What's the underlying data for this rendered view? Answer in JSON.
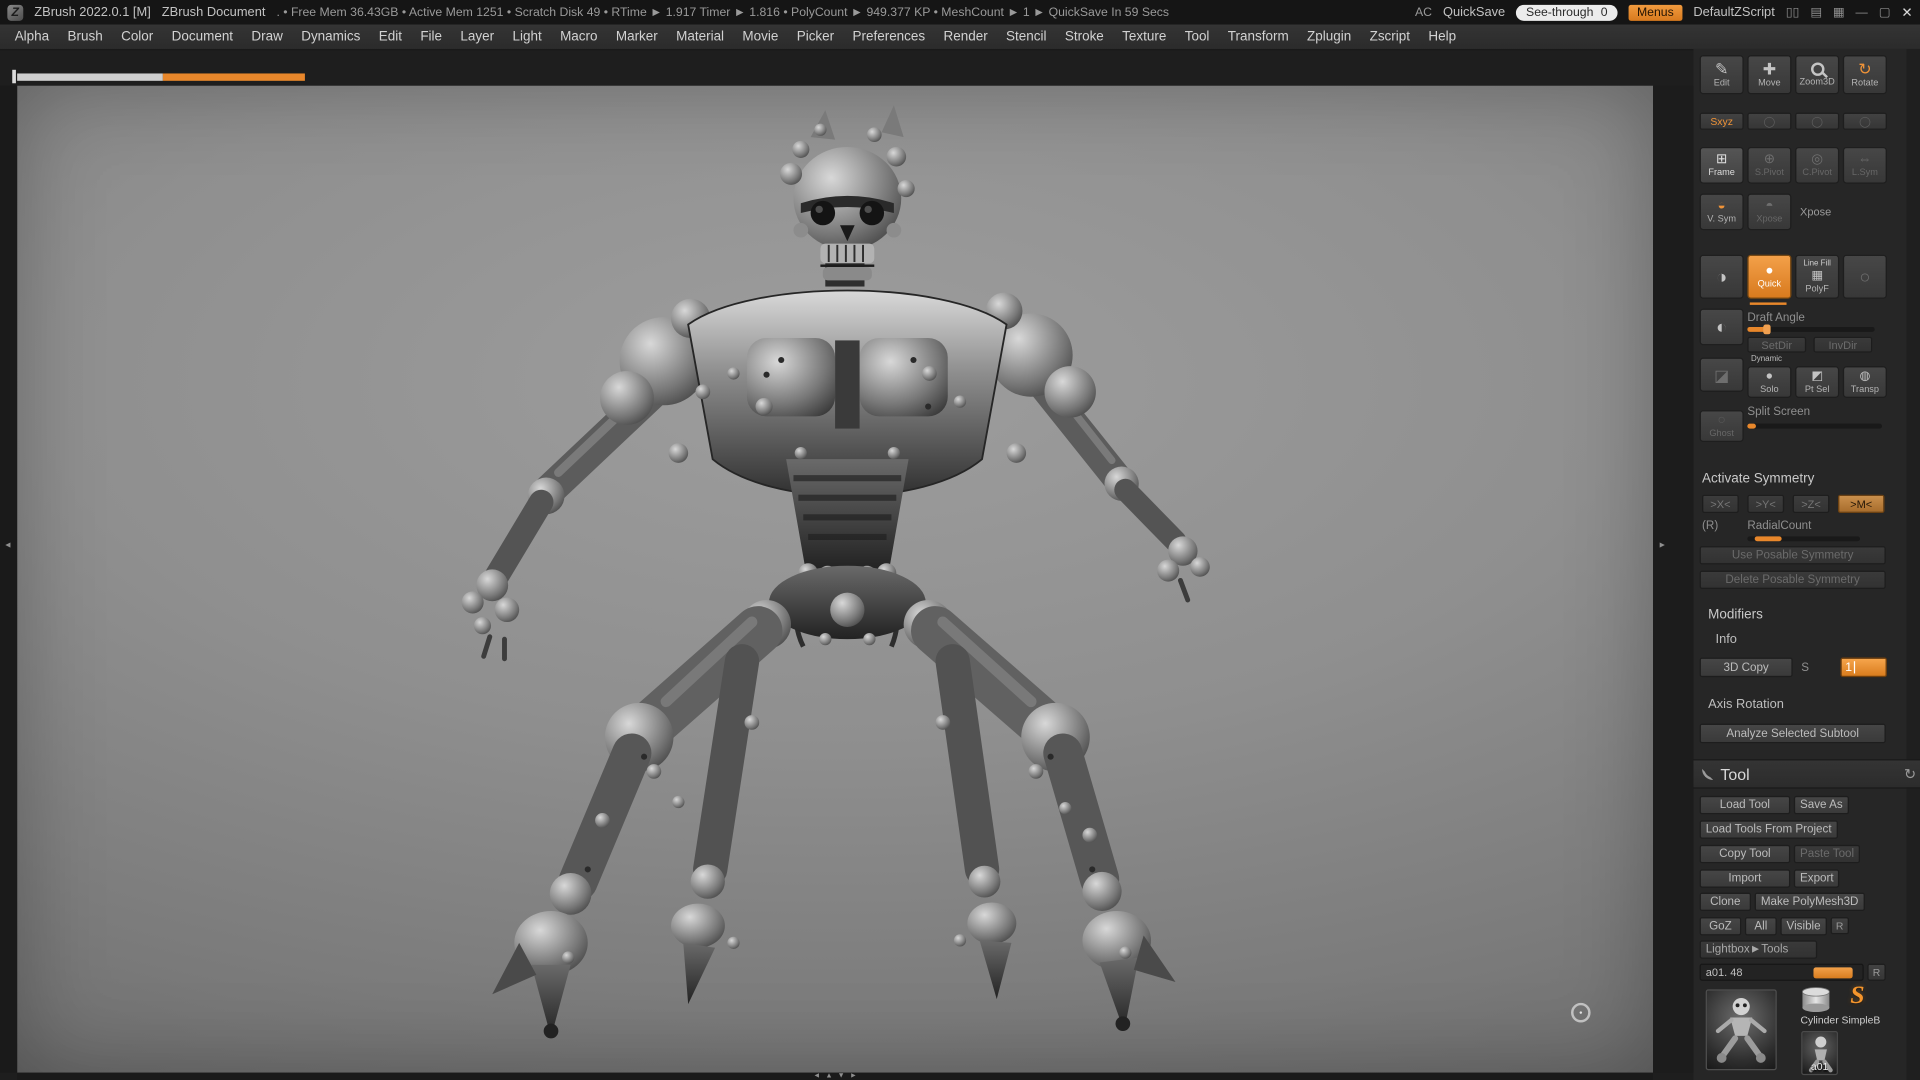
{
  "titlebar": {
    "app": "ZBrush 2022.0.1 [M]",
    "document": "ZBrush Document",
    "stats": ". • Free Mem 36.43GB • Active Mem 1251 • Scratch Disk 49 •  RTime ► 1.917 Timer ► 1.816 • PolyCount ► 949.377 KP • MeshCount ► 1   ► QuickSave In 59 Secs",
    "ac": "AC",
    "quicksave": "QuickSave",
    "see_through_label": "See-through",
    "see_through_value": "0",
    "menus": "Menus",
    "zscript": "DefaultZScript"
  },
  "menubar": {
    "items": [
      "Alpha",
      "Brush",
      "Color",
      "Document",
      "Draw",
      "Dynamics",
      "Edit",
      "File",
      "Layer",
      "Light",
      "Macro",
      "Marker",
      "Material",
      "Movie",
      "Picker",
      "Preferences",
      "Render",
      "Stencil",
      "Stroke",
      "Texture",
      "Tool",
      "Transform",
      "Zplugin",
      "Zscript",
      "Help"
    ]
  },
  "shelf": {
    "edit": "Edit",
    "move": "Move",
    "zoom3d": "Zoom3D",
    "rotate": "Rotate"
  },
  "transform": {
    "sxyz": "Sxyz",
    "frame": "Frame",
    "spivot": "S.Pivot",
    "cpivot": "C.Pivot",
    "lsym": "L.Sym",
    "vsym": "V. Sym",
    "xpose_btn": "Xpose",
    "xpose": "Xpose",
    "quick": "Quick",
    "line_fill": "Line Fill",
    "polyf": "PolyF",
    "draft_angle": "Draft Angle",
    "setdir": "SetDir",
    "invdir": "InvDir",
    "dynamic": "Dynamic",
    "solo": "Solo",
    "pt_sel": "Pt Sel",
    "transp": "Transp",
    "split_screen": "Split Screen",
    "ghost": "Ghost",
    "activate_symmetry": "Activate Symmetry",
    "sym_x": ">X<",
    "sym_y": ">Y<",
    "sym_z": ">Z<",
    "sym_m": ">M<",
    "r": "(R)",
    "radial_count": "RadialCount",
    "use_posable": "Use Posable Symmetry",
    "delete_posable": "Delete Posable Symmetry",
    "modifiers": "Modifiers",
    "info": "Info",
    "copy_3d": "3D Copy",
    "s": "S",
    "s_value": "1",
    "axis_rotation": "Axis Rotation",
    "analyze": "Analyze Selected Subtool"
  },
  "tool": {
    "title": "Tool",
    "load_tool": "Load Tool",
    "save_as": "Save As",
    "load_tools_from_project": "Load Tools From Project",
    "copy_tool": "Copy Tool",
    "paste_tool": "Paste Tool",
    "import": "Import",
    "export": "Export",
    "clone": "Clone",
    "make_polymesh3d": "Make PolyMesh3D",
    "goz": "GoZ",
    "all": "All",
    "visible": "Visible",
    "r": "R",
    "lightbox_tools": "Lightbox►Tools",
    "active_slider": "a01. 48",
    "slider_r": "R",
    "active_tool_name": "a01",
    "secondary_tool": "Cylinder SimpleB",
    "small_tool_name": "a01"
  },
  "icons": {
    "edit": "✎",
    "move": "✚",
    "rotate": "↻",
    "circle": "◯",
    "frame": "⊞",
    "s_pivot": "⊕",
    "c_pivot": "◎",
    "l_sym": "⇔",
    "v_sym": "◒",
    "xpose": "◓",
    "preview": "◑",
    "quick_sphere": "●",
    "polyf": "▦",
    "flat": "○",
    "draft": "◐",
    "cube": "◪",
    "solo": "●",
    "pt_sel": "◩",
    "transp": "◍",
    "ghost": "◌",
    "refresh": "↻",
    "panel_a": "▯▯",
    "panel_b": "▤",
    "panel_c": "▦",
    "minimize": "—",
    "maximize": "▢",
    "close": "✕",
    "sculptris_logo": "S"
  },
  "nav": {
    "left": "◄",
    "right": "►",
    "up": "▲",
    "down": "▼"
  },
  "colors": {
    "accent": "#E8872B",
    "canvas_top": "#9D9D9D",
    "canvas_bottom": "#686868"
  }
}
